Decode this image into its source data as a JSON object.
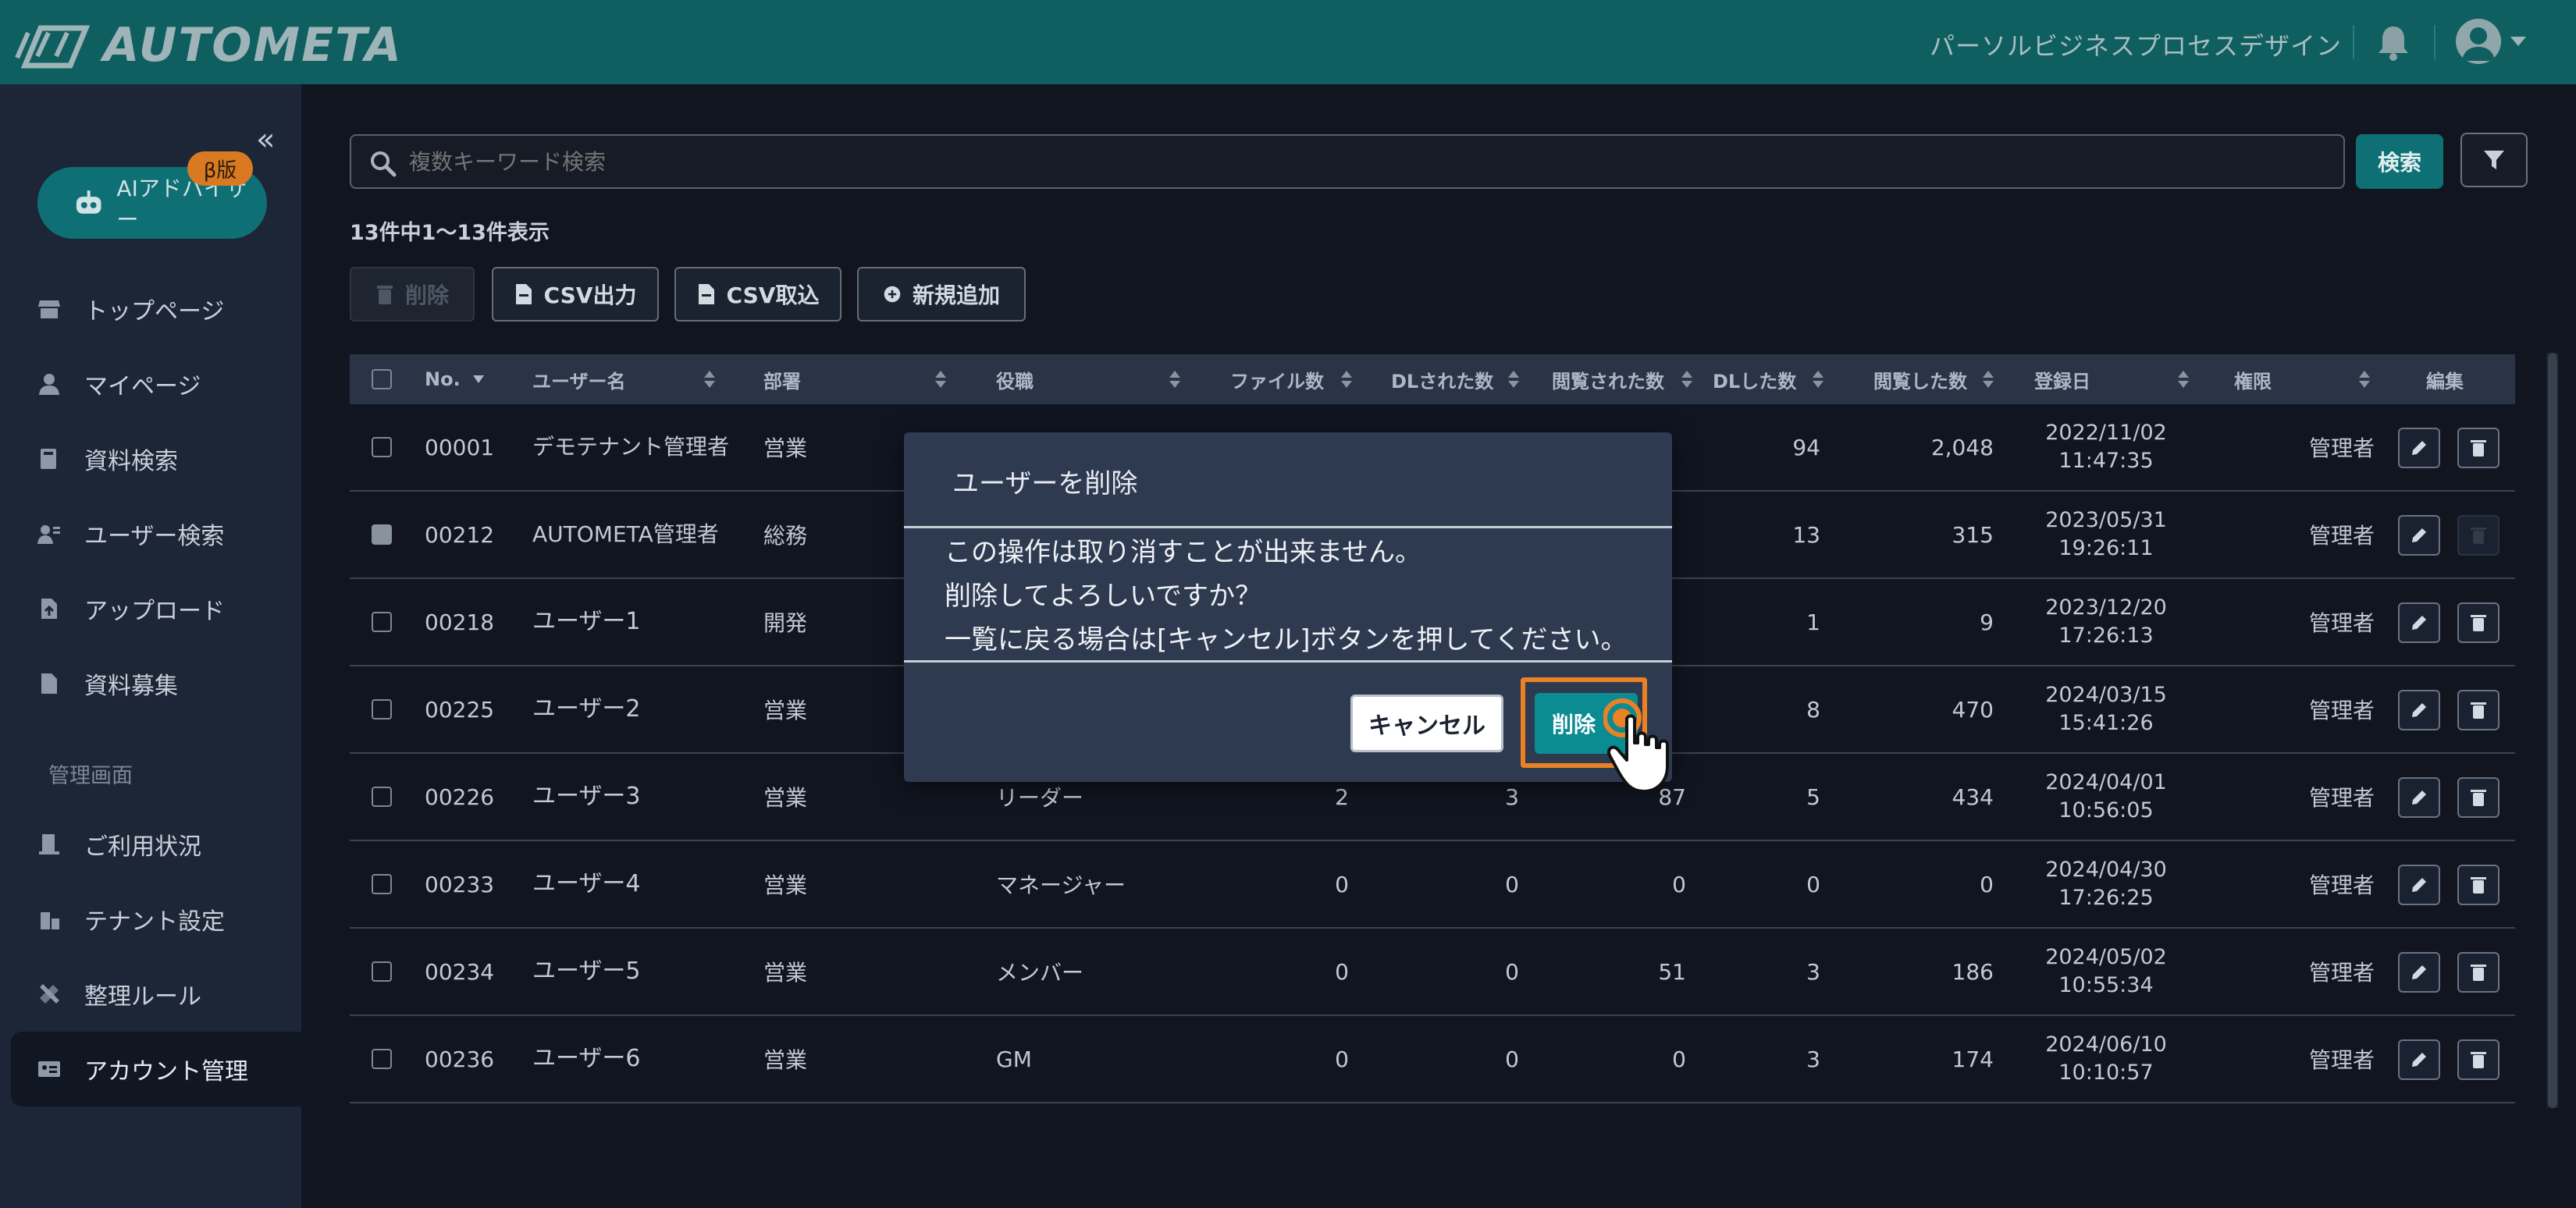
{
  "header": {
    "logo_text": "AUTOMETA",
    "company": "パーソルビジネスプロセスデザイン"
  },
  "sidebar": {
    "ai_advisor": "AIアドバイザー",
    "beta_badge": "β版",
    "items": [
      {
        "label": "トップページ",
        "icon": "store-icon"
      },
      {
        "label": "マイページ",
        "icon": "user-icon"
      },
      {
        "label": "資料検索",
        "icon": "book-icon"
      },
      {
        "label": "ユーザー検索",
        "icon": "user-search-icon"
      },
      {
        "label": "アップロード",
        "icon": "file-upload-icon"
      },
      {
        "label": "資料募集",
        "icon": "file-icon"
      }
    ],
    "section_label": "管理画面",
    "admin_items": [
      {
        "label": "ご利用状況",
        "icon": "building-icon"
      },
      {
        "label": "テナント設定",
        "icon": "tenant-icon"
      },
      {
        "label": "整理ルール",
        "icon": "tools-icon"
      },
      {
        "label": "アカウント管理",
        "icon": "id-card-icon"
      }
    ]
  },
  "search": {
    "placeholder": "複数キーワード検索",
    "button": "検索"
  },
  "result_count": "13件中1〜13件表示",
  "toolbar": {
    "delete": "削除",
    "csv_export": "CSV出力",
    "csv_import": "CSV取込",
    "add_new": "新規追加"
  },
  "table": {
    "columns": [
      "No.",
      "ユーザー名",
      "部署",
      "役職",
      "ファイル数",
      "DLされた数",
      "閲覧された数",
      "DLした数",
      "閲覧した数",
      "登録日",
      "権限",
      "編集"
    ],
    "rows": [
      {
        "no": "00001",
        "name": "デモテナント管理者",
        "dept": "営業",
        "role": "",
        "files": "",
        "dled": "",
        "viewed": "",
        "dl": "94",
        "view": "2,048",
        "date": "2022/11/02",
        "time": "11:47:35",
        "perm": "管理者"
      },
      {
        "no": "00212",
        "name": "AUTOMETA管理者",
        "dept": "総務",
        "role": "",
        "files": "",
        "dled": "",
        "viewed": "",
        "dl": "13",
        "view": "315",
        "date": "2023/05/31",
        "time": "19:26:11",
        "perm": "管理者"
      },
      {
        "no": "00218",
        "name": "ユーザー1",
        "dept": "開発",
        "role": "",
        "files": "",
        "dled": "",
        "viewed": "",
        "dl": "1",
        "view": "9",
        "date": "2023/12/20",
        "time": "17:26:13",
        "perm": "管理者"
      },
      {
        "no": "00225",
        "name": "ユーザー2",
        "dept": "営業",
        "role": "",
        "files": "",
        "dled": "",
        "viewed": "",
        "dl": "8",
        "view": "470",
        "date": "2024/03/15",
        "time": "15:41:26",
        "perm": "管理者"
      },
      {
        "no": "00226",
        "name": "ユーザー3",
        "dept": "営業",
        "role": "リーダー",
        "files": "2",
        "dled": "3",
        "viewed": "87",
        "dl": "5",
        "view": "434",
        "date": "2024/04/01",
        "time": "10:56:05",
        "perm": "管理者"
      },
      {
        "no": "00233",
        "name": "ユーザー4",
        "dept": "営業",
        "role": "マネージャー",
        "files": "0",
        "dled": "0",
        "viewed": "0",
        "dl": "0",
        "view": "0",
        "date": "2024/04/30",
        "time": "17:26:25",
        "perm": "管理者"
      },
      {
        "no": "00234",
        "name": "ユーザー5",
        "dept": "営業",
        "role": "メンバー",
        "files": "0",
        "dled": "0",
        "viewed": "51",
        "dl": "3",
        "view": "186",
        "date": "2024/05/02",
        "time": "10:55:34",
        "perm": "管理者"
      },
      {
        "no": "00236",
        "name": "ユーザー6",
        "dept": "営業",
        "role": "GM",
        "files": "0",
        "dled": "0",
        "viewed": "0",
        "dl": "3",
        "view": "174",
        "date": "2024/06/10",
        "time": "10:10:57",
        "perm": "管理者"
      }
    ]
  },
  "modal": {
    "title": "ユーザーを削除",
    "line1": "この操作は取り消すことが出来ません。",
    "line2": "削除してよろしいですか？",
    "line3": "一覧に戻る場合は[キャンセル]ボタンを押してください。",
    "cancel": "キャンセル",
    "delete": "削除"
  }
}
